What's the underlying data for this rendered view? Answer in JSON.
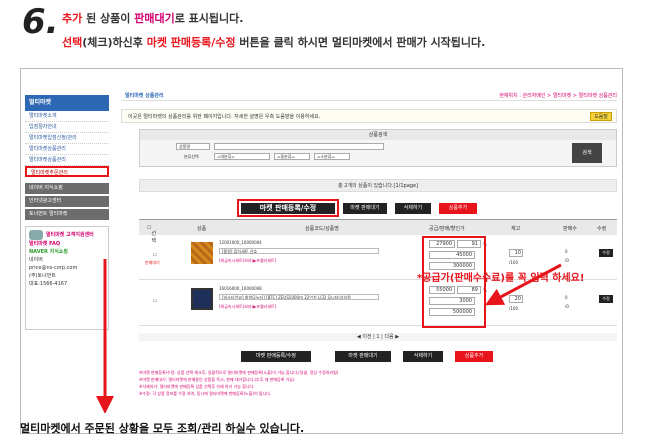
{
  "step": {
    "number": "6.",
    "line1_a": "추가",
    "line1_b": " 된 상품이 ",
    "line1_c": "판매대기",
    "line1_d": "로 표시됩니다.",
    "line2_a": "선택",
    "line2_b": "(체크)하신후 ",
    "line2_c": "마켓 판매등록/수정",
    "line2_d": " 버튼을 클릭 하시면 멀티마켓에서 판매가 시작됩니다."
  },
  "sidebar": {
    "header": "멀티마켓",
    "items": [
      "멀티마켓소개",
      "입점절차안내",
      "멀티마켓입점신청/관리",
      "멀티마켓상품관리",
      "멀티마켓상품관리",
      "멀티마켓주문관리"
    ],
    "gray_items": [
      "네이버 지식쇼핑",
      "인터넷광고센터",
      "토너먼트 멀티마켓"
    ],
    "box_title": "멀티마켓 고객지원센터",
    "box_faq": "멀티마켓 FAQ",
    "box_naver": "NAVER 지식쇼핑",
    "box_contact": [
      "네이버",
      "price@ns-corp.com",
      "(주)토너먼트",
      "대표:1566-4167"
    ]
  },
  "main": {
    "title": "멀티마켓 상품관리",
    "breadcrumb": "현재위치 : 관리자메인 > 멀티마켓 > 멀티마켓 상품관리",
    "notice": "이곳은 멀티마켓의 상품관리를 위한 페이지입니다. 자세한 설명은 우측 도움말을 이용하세요.",
    "help_label": "도움말",
    "search_caption": "상품검색",
    "search_field": "상품명",
    "category_label": "분류선택",
    "cat1": "=대분류=",
    "cat2": "=중분류=",
    "cat3": "=소분류=",
    "search_button": "검색",
    "status_text": "총 2개의 상품이 있습니다.[1/1page]",
    "btn_register": "마켓 판매등록/수정",
    "btn_pause": "마켓 판매대기",
    "btn_delete": "삭제하기",
    "btn_add": "상품추가",
    "col_select": "선택",
    "col_product": "상품",
    "col_code": "상품코드/상품명",
    "col_price": "공급/판매/할인가",
    "col_stock": "재고",
    "col_sold": "판매수",
    "col_edit": "수정",
    "pager": "◀ 이전 | 1 | 다음 ▶",
    "rows": [
      {
        "code": "12001000_10000004",
        "name": "[홍원] 참치세트 선호",
        "tag": "[위급속시세트(보라)▶프렐리세트]",
        "status": "판매대기",
        "price": "27900",
        "pct": "91",
        "sale": "45000",
        "list": "300000",
        "stock": "10",
        "stock_total": "/100",
        "sold": "0",
        "sold_total": "/0",
        "edit": "수정"
      },
      {
        "code": "16016000_10000008",
        "name": "[비스티안코] 최첨모뉴터] [BTC] ZEUS5000m 22인치 LCD 모니터(삼성용",
        "tag": "[위급속시세트(보라)▶프렐리세트]",
        "status": "",
        "price": "55000",
        "pct": "89",
        "sale": "3000",
        "list": "500000",
        "stock": "20",
        "stock_total": "/100",
        "sold": "0",
        "sold_total": "/0",
        "edit": "수정"
      }
    ],
    "notes": [
      "※마켓 판매등록/수정: 상품 선택 체크후, 일괄적으로 멀티마켓에 판매등록(노출)이 가능 합니다.(일괄, 정상 수정처리됨)",
      "※마켓 판매대기: 멀티마켓에 판매중인 상품을 즉시, 판매 대기합니다.(추후 재 판매등록 가능)",
      "※삭제하기: 멀티마켓에 판매등록 상품 선택후 삭제 하기 가능 합니다.",
      "※수정: 각 상품 정보를 수정 하여, 동시에 멀티마켓에 판매등록(노출)이 됩니다."
    ]
  },
  "callout": "*공급가(판매수수료)를 꼭 입력 하세요!",
  "caption": "멀티마켓에서 주문된 상황을 모두 조회/관리 하실수 있습니다.",
  "colors": {
    "accent": "#e8141c",
    "magenta": "#d4006e",
    "nav": "#2d68b5"
  }
}
